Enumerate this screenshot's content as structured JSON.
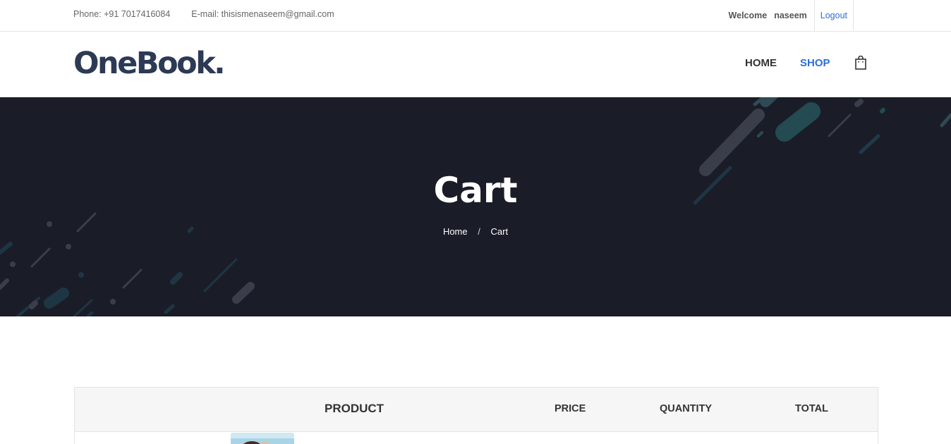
{
  "topbar": {
    "phone": "Phone: +91 7017416084",
    "email": "E-mail: thisismenaseem@gmail.com",
    "welcome": "Welcome",
    "username": "naseem",
    "logout": "Logout"
  },
  "header": {
    "logo": "OneBook.",
    "nav": {
      "home": "HOME",
      "shop": "SHOP"
    },
    "cart_icon": "shopping-bag-icon"
  },
  "banner": {
    "title": "Cart",
    "breadcrumb": {
      "home": "Home",
      "separator": "/",
      "current": "Cart"
    }
  },
  "cart": {
    "columns": {
      "product": "PRODUCT",
      "price": "PRICE",
      "quantity": "QUANTITY",
      "total": "TOTAL"
    }
  },
  "colors": {
    "brand": "#2c3a55",
    "accent": "#2a6fd6",
    "banner_bg": "#1a1d27"
  }
}
